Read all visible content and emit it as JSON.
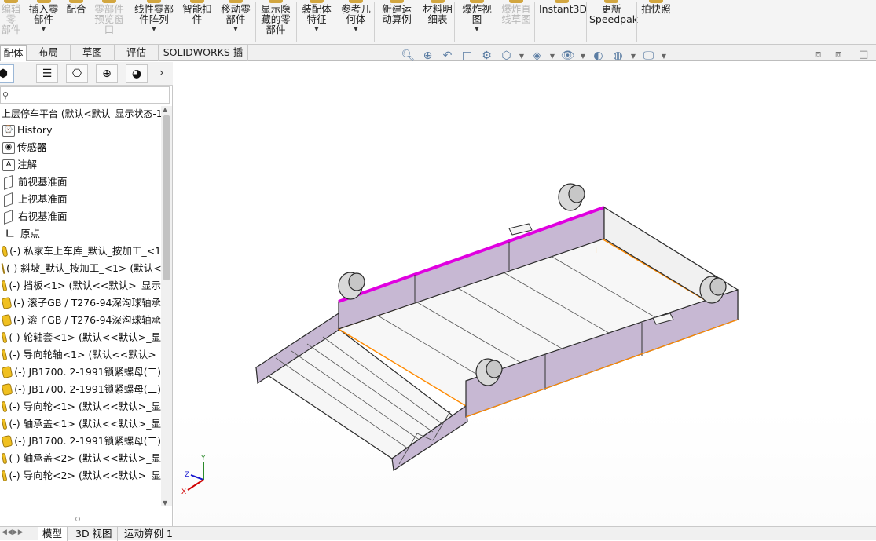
{
  "ribbon": {
    "groups": [
      {
        "label": "编辑零\n部件",
        "disabled": true,
        "caret": false
      },
      {
        "label": "插入零\n部件",
        "disabled": false,
        "caret": true
      },
      {
        "label": "配合",
        "disabled": false,
        "caret": false
      },
      {
        "label": "零部件\n预览窗\n口",
        "disabled": true,
        "caret": false
      },
      {
        "label": "线性零部\n件阵列",
        "disabled": false,
        "caret": true
      },
      {
        "label": "智能扣\n件",
        "disabled": false,
        "caret": false
      },
      {
        "label": "移动零\n部件",
        "disabled": false,
        "caret": true
      },
      {
        "label": "显示隐\n藏的零\n部件",
        "disabled": false,
        "caret": false
      },
      {
        "label": "装配体\n特征",
        "disabled": false,
        "caret": true
      },
      {
        "label": "参考几\n何体",
        "disabled": false,
        "caret": true
      },
      {
        "label": "新建运\n动算例",
        "disabled": false,
        "caret": false
      },
      {
        "label": "材料明\n细表",
        "disabled": false,
        "caret": false
      },
      {
        "label": "爆炸视\n图",
        "disabled": false,
        "caret": true
      },
      {
        "label": "爆炸直\n线草图",
        "disabled": true,
        "caret": false
      },
      {
        "label": "Instant3D",
        "disabled": false,
        "caret": false
      },
      {
        "label": "更新\nSpeedpak",
        "disabled": false,
        "caret": false
      },
      {
        "label": "拍快照",
        "disabled": false,
        "caret": false
      }
    ]
  },
  "tabs": [
    "配体",
    "布局",
    "草图",
    "评估",
    "SOLIDWORKS 插件"
  ],
  "view_tools": [
    "magnify-icon",
    "zoom-area-icon",
    "previous-view-icon",
    "section-view-icon",
    "dynamic-annotation-icon",
    "view-orientation-icon",
    "display-style-icon",
    "hide-show-icon",
    "edit-appearance-icon",
    "scenes-icon",
    "display-settings-icon"
  ],
  "panel": {
    "tab_icons": [
      "feature-manager-icon",
      "property-manager-icon",
      "configuration-manager-icon",
      "dimxpert-icon",
      "display-manager-icon"
    ],
    "filter_text": "",
    "root": "上层停车平台 (默认<默认_显示状态-1",
    "items": [
      {
        "label": "History",
        "icon": "history-icon",
        "type": "box"
      },
      {
        "label": "传感器",
        "icon": "sensor-icon",
        "type": "box"
      },
      {
        "label": "注解",
        "icon": "annotation-icon",
        "type": "box"
      },
      {
        "label": "前视基准面",
        "icon": "plane-icon",
        "type": "plane"
      },
      {
        "label": "上视基准面",
        "icon": "plane-icon",
        "type": "plane"
      },
      {
        "label": "右视基准面",
        "icon": "plane-icon",
        "type": "plane"
      },
      {
        "label": "原点",
        "icon": "origin-icon",
        "type": "origin"
      },
      {
        "label": "(-) 私家车上车库_默认_按加工_<1",
        "icon": "part-icon",
        "type": "part"
      },
      {
        "label": "(-) 斜坡_默认_按加工_<1> (默认<",
        "icon": "part-icon",
        "type": "part"
      },
      {
        "label": "(-) 挡板<1> (默认<<默认>_显示",
        "icon": "part-icon",
        "type": "part"
      },
      {
        "label": "(-) 滚子GB / T276-94深沟球轴承",
        "icon": "part-icon",
        "type": "part"
      },
      {
        "label": "(-) 滚子GB / T276-94深沟球轴承",
        "icon": "part-icon",
        "type": "part"
      },
      {
        "label": "(-) 轮轴套<1> (默认<<默认>_显",
        "icon": "part-icon",
        "type": "part"
      },
      {
        "label": "(-) 导向轮轴<1> (默认<<默认>_",
        "icon": "part-icon",
        "type": "part"
      },
      {
        "label": "(-) JB1700. 2-1991锁紧螺母(二)",
        "icon": "part-icon",
        "type": "part"
      },
      {
        "label": "(-) JB1700. 2-1991锁紧螺母(二)",
        "icon": "part-icon",
        "type": "part"
      },
      {
        "label": "(-) 导向轮<1> (默认<<默认>_显",
        "icon": "part-icon",
        "type": "part"
      },
      {
        "label": "(-) 轴承盖<1> (默认<<默认>_显",
        "icon": "part-icon",
        "type": "part"
      },
      {
        "label": "(-) JB1700. 2-1991锁紧螺母(二)",
        "icon": "part-icon",
        "type": "part"
      },
      {
        "label": "(-) 轴承盖<2> (默认<<默认>_显",
        "icon": "part-icon",
        "type": "part"
      },
      {
        "label": "(-) 导向轮<2> (默认<<默认>_显",
        "icon": "part-icon",
        "type": "part"
      }
    ]
  },
  "bottom_tabs": [
    "模型",
    "3D 视图",
    "运动算例 1"
  ],
  "triad": {
    "x": "X",
    "y": "Y",
    "z": "Z"
  },
  "colors": {
    "body": "#c7b8d3",
    "edge": "#2b2b2b",
    "highlight": "#e000e0",
    "selection": "#ff8a00",
    "floor": "#f7f7f7"
  }
}
